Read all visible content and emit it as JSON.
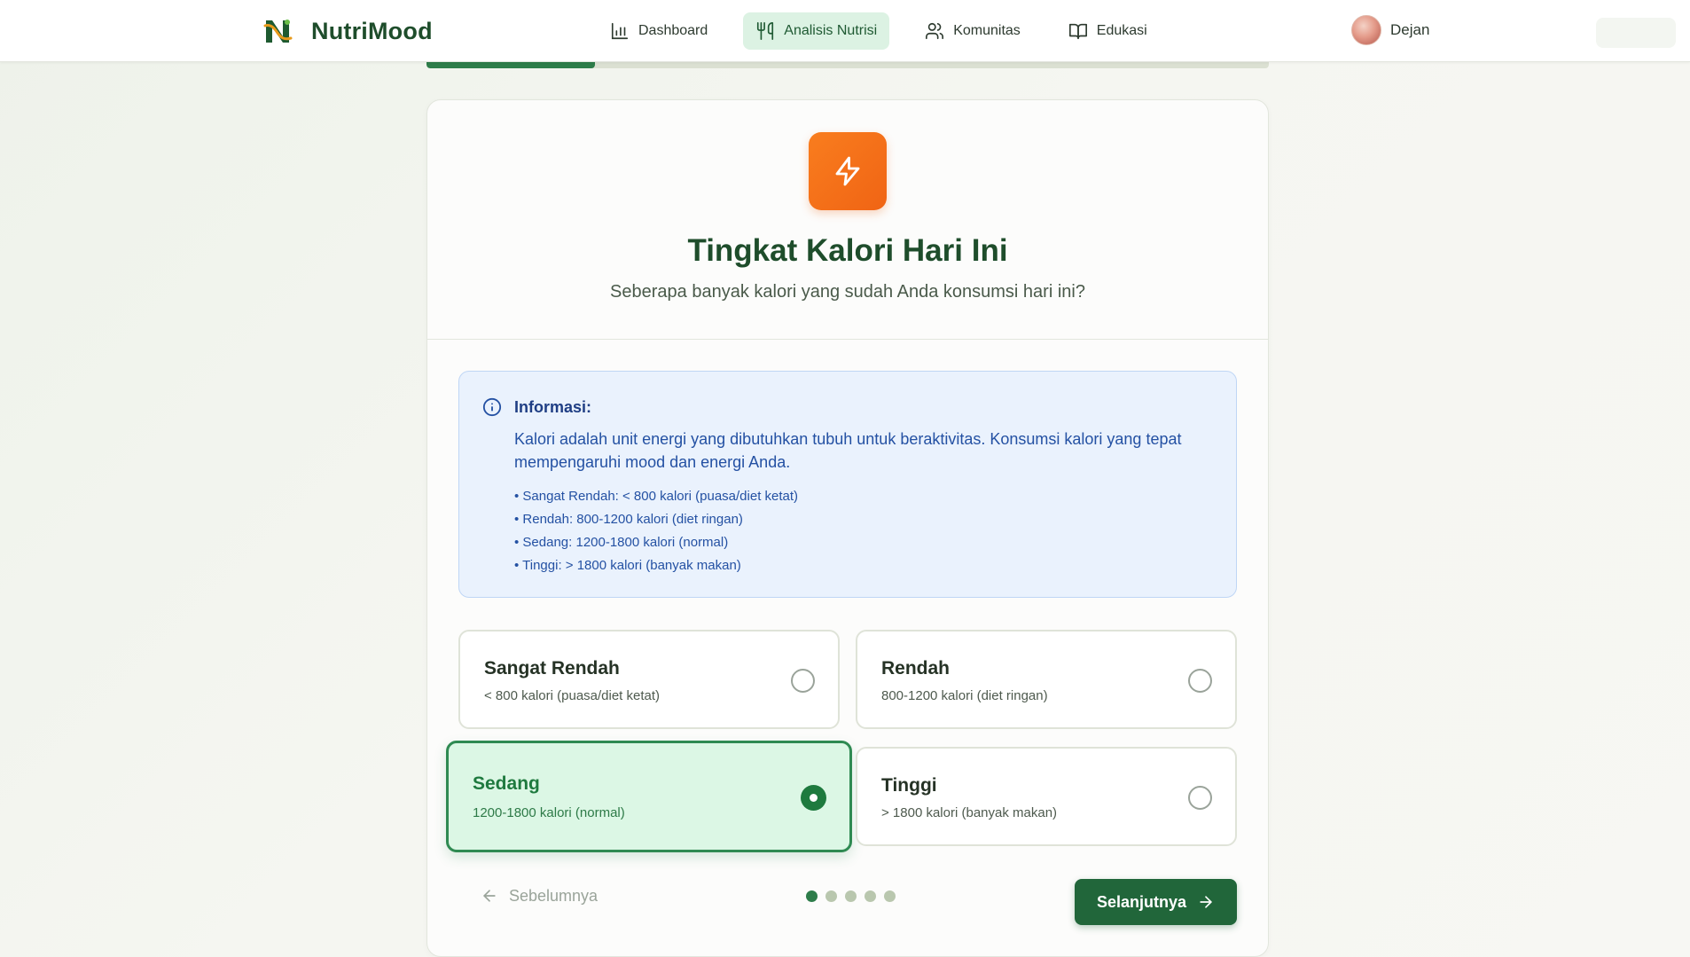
{
  "app": {
    "name": "NutriMood"
  },
  "nav": {
    "items": [
      {
        "label": "Dashboard",
        "icon": "bar-chart-icon",
        "active": false
      },
      {
        "label": "Analisis Nutrisi",
        "icon": "utensils-icon",
        "active": true
      },
      {
        "label": "Komunitas",
        "icon": "users-icon",
        "active": false
      },
      {
        "label": "Edukasi",
        "icon": "book-icon",
        "active": false
      }
    ]
  },
  "user": {
    "name": "Dejan"
  },
  "progress": {
    "fraction": 0.2
  },
  "question": {
    "icon": "zap-icon",
    "title": "Tingkat Kalori Hari Ini",
    "subtitle": "Seberapa banyak kalori yang sudah Anda konsumsi hari ini?"
  },
  "info": {
    "icon": "info-icon",
    "title": "Informasi:",
    "text": "Kalori adalah unit energi yang dibutuhkan tubuh untuk beraktivitas. Konsumsi kalori yang tepat mempengaruhi mood dan energi Anda.",
    "list": [
      "• Sangat Rendah: < 800 kalori (puasa/diet ketat)",
      "• Rendah: 800-1200 kalori (diet ringan)",
      "• Sedang: 1200-1800 kalori (normal)",
      "• Tinggi: > 1800 kalori (banyak makan)"
    ]
  },
  "options": [
    {
      "title": "Sangat Rendah",
      "desc": "< 800 kalori (puasa/diet ketat)",
      "selected": false
    },
    {
      "title": "Rendah",
      "desc": "800-1200 kalori (diet ringan)",
      "selected": false
    },
    {
      "title": "Sedang",
      "desc": "1200-1800 kalori (normal)",
      "selected": true
    },
    {
      "title": "Tinggi",
      "desc": "> 1800 kalori (banyak makan)",
      "selected": false
    }
  ],
  "footer": {
    "prev_label": "Sebelumnya",
    "next_label": "Selanjutnya",
    "steps_total": 5,
    "step_current": 1
  },
  "colors": {
    "brand": "#1e4d2b",
    "accent": "#2e7d4a",
    "icon_orange": "#f97d1e",
    "info_blue": "#2451a3"
  }
}
